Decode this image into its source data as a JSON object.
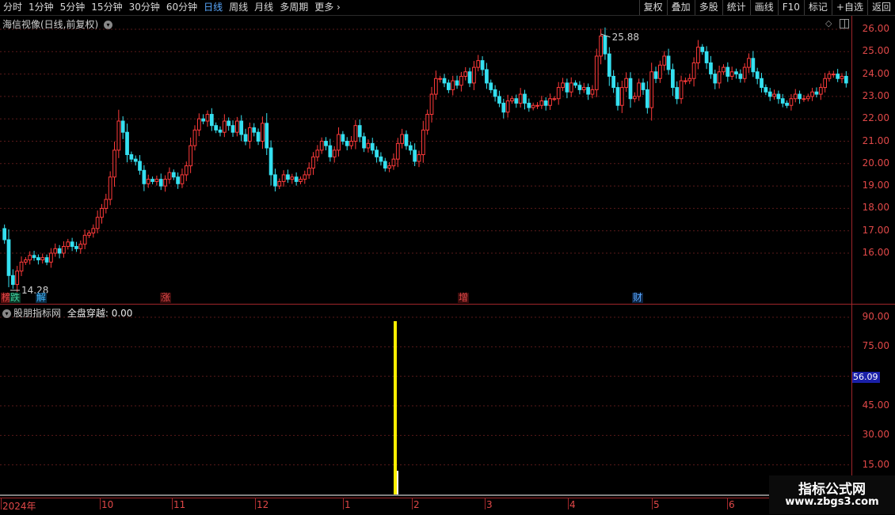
{
  "toolbar": {
    "tabs": [
      "分时",
      "1分钟",
      "5分钟",
      "15分钟",
      "30分钟",
      "60分钟",
      "日线",
      "周线",
      "月线",
      "多周期",
      "更多"
    ],
    "active_tab": "日线",
    "right_buttons": [
      "复权",
      "叠加",
      "多股",
      "统计",
      "画线",
      "F10",
      "标记",
      "+自选",
      "返回"
    ]
  },
  "main": {
    "title": "海信视像(日线,前复权)",
    "high_label": "25.88",
    "low_label": "14.28",
    "price_ticks": [
      "26.00",
      "25.00",
      "24.00",
      "23.00",
      "22.00",
      "21.00",
      "20.00",
      "19.00",
      "18.00",
      "17.00",
      "16.00"
    ],
    "events": [
      {
        "text": "榜",
        "color": "#e04848",
        "bg": "#5a1010"
      },
      {
        "text": "跌",
        "color": "#3fd0a0",
        "bg": "#0c3a28"
      },
      {
        "text": "解",
        "color": "#3fb8ff",
        "bg": "#0c2c44"
      },
      {
        "text": "涨",
        "color": "#e04848",
        "bg": "#3c0c0c"
      },
      {
        "text": "增",
        "color": "#e04848",
        "bg": "#3c0c0c"
      },
      {
        "text": "财",
        "color": "#5aa9ff",
        "bg": "#0c2444"
      }
    ]
  },
  "sub": {
    "indicator_name": "股朋指标网",
    "series_name": "全盘穿越",
    "value": "0.00",
    "ticks": [
      "90.00",
      "75.00",
      "45.00",
      "30.00",
      "15.00"
    ],
    "current_value": "56.09"
  },
  "time_axis": [
    "2024年",
    "10",
    "11",
    "12",
    "1",
    "2",
    "3",
    "4",
    "5",
    "6"
  ],
  "watermark": {
    "title": "指标公式网",
    "url": "www.zbgs3.com"
  },
  "colors": {
    "up": "#ff3a3a",
    "down": "#35e0f0",
    "signal": "#ffee00",
    "axis": "#a0262a"
  },
  "chart_data": [
    {
      "type": "candlestick",
      "title": "海信视像(日线,前复权)",
      "ylim": [
        14.0,
        26.5
      ],
      "annotations": {
        "max": 25.88,
        "min": 14.28
      },
      "close": [
        16.6,
        15.0,
        14.6,
        15.2,
        15.6,
        15.7,
        15.9,
        15.8,
        15.7,
        15.8,
        15.6,
        16.0,
        16.2,
        16.0,
        16.3,
        16.5,
        16.3,
        16.2,
        16.4,
        16.8,
        16.9,
        17.1,
        17.6,
        18.0,
        18.4,
        19.4,
        20.6,
        21.9,
        21.4,
        20.4,
        20.2,
        20.1,
        19.7,
        19.1,
        19.3,
        19.2,
        19.3,
        19.0,
        19.3,
        19.6,
        19.4,
        19.1,
        19.5,
        19.9,
        20.8,
        21.5,
        22.0,
        21.9,
        22.2,
        21.7,
        21.5,
        21.4,
        21.9,
        21.7,
        21.4,
        21.9,
        21.3,
        21.0,
        21.6,
        21.4,
        21.0,
        21.8,
        20.7,
        19.5,
        19.0,
        19.2,
        19.5,
        19.3,
        19.4,
        19.2,
        19.3,
        19.5,
        19.8,
        20.3,
        20.6,
        21.0,
        20.8,
        20.3,
        20.6,
        21.3,
        21.0,
        20.8,
        21.0,
        21.7,
        21.2,
        20.7,
        20.9,
        20.6,
        20.3,
        20.1,
        19.8,
        19.9,
        20.2,
        20.9,
        21.3,
        20.8,
        20.6,
        20.1,
        20.4,
        21.5,
        22.2,
        23.1,
        23.8,
        23.8,
        23.6,
        23.3,
        23.7,
        23.5,
        23.9,
        24.1,
        23.6,
        24.3,
        24.6,
        24.2,
        23.6,
        23.3,
        23.0,
        22.7,
        22.3,
        22.8,
        22.9,
        22.7,
        23.1,
        22.7,
        22.5,
        22.6,
        22.6,
        22.8,
        22.6,
        22.9,
        22.9,
        23.4,
        23.6,
        23.2,
        23.6,
        23.5,
        23.3,
        23.4,
        23.1,
        23.3,
        24.8,
        25.7,
        24.9,
        23.9,
        23.4,
        22.6,
        23.4,
        23.8,
        22.9,
        23.0,
        23.6,
        23.3,
        22.5,
        24.1,
        23.8,
        24.4,
        24.8,
        24.2,
        23.4,
        22.9,
        23.7,
        23.7,
        23.8,
        24.5,
        25.2,
        25.0,
        24.5,
        24.0,
        23.6,
        24.1,
        24.3,
        23.9,
        24.1,
        24.0,
        23.8,
        24.3,
        24.7,
        24.1,
        23.8,
        23.4,
        23.2,
        23.0,
        23.1,
        22.9,
        22.7,
        22.6,
        22.9,
        23.1,
        22.9,
        22.9,
        23.0,
        23.2,
        23.1,
        23.4,
        23.8,
        24.0,
        24.0,
        23.8,
        23.9,
        23.6
      ]
    },
    {
      "type": "bar",
      "title": "全盘穿越",
      "ylim": [
        0,
        100
      ],
      "signals": [
        {
          "index": 91,
          "value": 88
        },
        {
          "index": 92,
          "value": 12
        }
      ]
    }
  ]
}
